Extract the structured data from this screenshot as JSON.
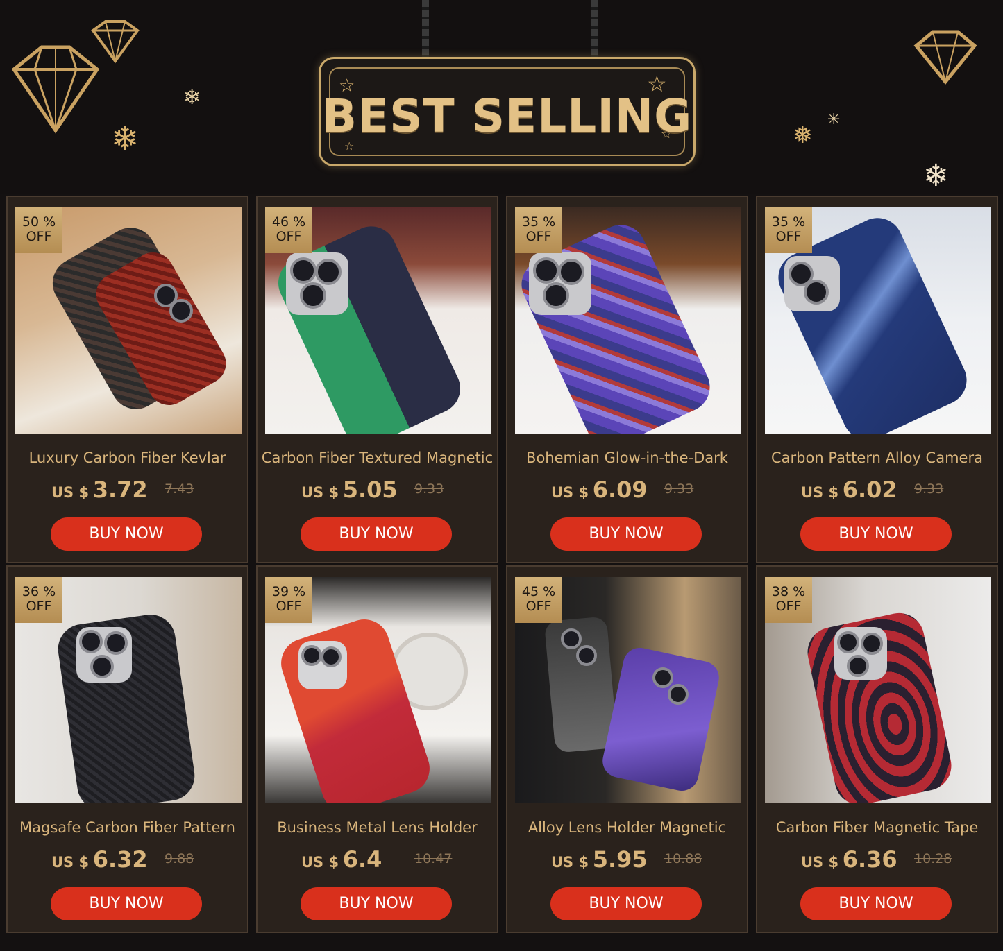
{
  "banner": {
    "title": "BEST SELLING"
  },
  "labels": {
    "currency": "US $",
    "off": "OFF",
    "buy_now": "BUY NOW"
  },
  "colors": {
    "accent_gold": "#d9b57c",
    "button_red": "#d9301c",
    "card_bg": "#2a221c",
    "page_bg": "#141111"
  },
  "products": [
    {
      "discount": "50 %",
      "title": "Luxury Carbon Fiber Kevlar",
      "price": "3.72",
      "original_price": "7.43"
    },
    {
      "discount": "46 %",
      "title": "Carbon Fiber Textured Magnetic",
      "price": "5.05",
      "original_price": "9.33"
    },
    {
      "discount": "35 %",
      "title": "Bohemian Glow-in-the-Dark",
      "price": "6.09",
      "original_price": "9.33"
    },
    {
      "discount": "35 %",
      "title": "Carbon Pattern Alloy Camera",
      "price": "6.02",
      "original_price": "9.33"
    },
    {
      "discount": "36 %",
      "title": "Magsafe Carbon Fiber Pattern",
      "price": "6.32",
      "original_price": "9.88"
    },
    {
      "discount": "39 %",
      "title": "Business Metal Lens Holder",
      "price": "6.4",
      "original_price": "10.47"
    },
    {
      "discount": "45 %",
      "title": "Alloy Lens Holder Magnetic",
      "price": "5.95",
      "original_price": "10.88"
    },
    {
      "discount": "38 %",
      "title": "Carbon Fiber Magnetic Tape",
      "price": "6.36",
      "original_price": "10.28"
    }
  ]
}
